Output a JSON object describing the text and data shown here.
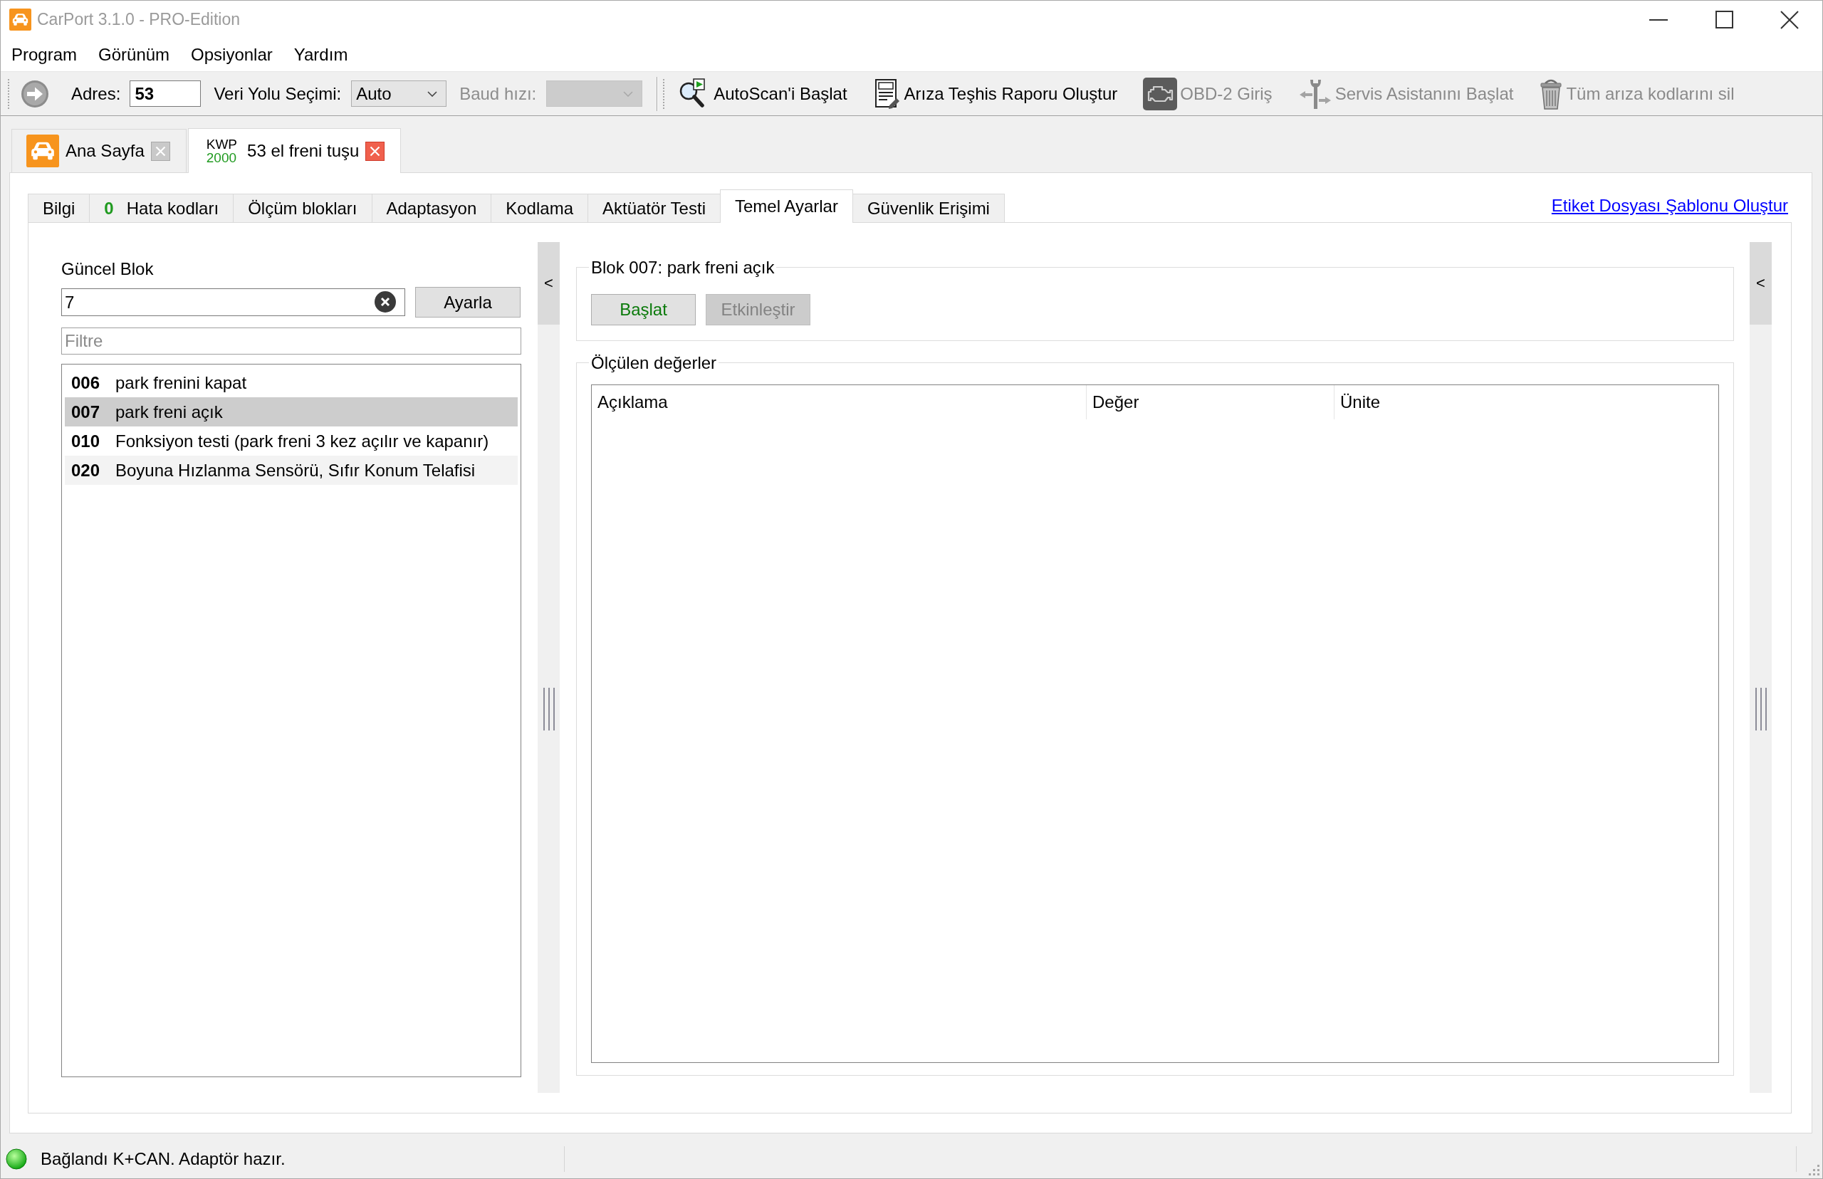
{
  "window": {
    "title": "CarPort 3.1.0 - PRO-Edition"
  },
  "menu": [
    "Program",
    "Görünüm",
    "Opsiyonlar",
    "Yardım"
  ],
  "toolbar": {
    "address": {
      "label": "Adres:",
      "value": "53"
    },
    "bus_select": {
      "label": "Veri Yolu Seçimi:",
      "value": "Auto"
    },
    "baud_select": {
      "label": "Baud hızı:",
      "disabled": true
    },
    "actions": [
      {
        "kind": "autoscan",
        "label": "AutoScan'i Başlat",
        "disabled": false
      },
      {
        "kind": "report",
        "label": "Arıza Teşhis Raporu Oluştur",
        "disabled": false
      },
      {
        "kind": "obd",
        "label": "OBD-2 Giriş",
        "disabled": true
      },
      {
        "kind": "service",
        "label": "Servis Asistanını Başlat",
        "disabled": true
      },
      {
        "kind": "clear_codes",
        "label": "Tüm arıza kodlarını sil",
        "disabled": true
      }
    ]
  },
  "document_tabs": [
    {
      "kind": "home",
      "label": "Ana Sayfa",
      "selected": false
    },
    {
      "kind": "module",
      "protocol": [
        "KWP",
        "2000"
      ],
      "label": "53 el freni tuşu",
      "selected": true
    }
  ],
  "module_tabs": [
    {
      "label": "Bilgi",
      "selected": false
    },
    {
      "count": "0",
      "label": "Hata kodları",
      "selected": false
    },
    {
      "label": "Ölçüm blokları",
      "selected": false
    },
    {
      "label": "Adaptasyon",
      "selected": false
    },
    {
      "label": "Kodlama",
      "selected": false
    },
    {
      "label": "Aktüatör Testi",
      "selected": false
    },
    {
      "label": "Temel Ayarlar",
      "selected": true
    },
    {
      "label": "Güvenlik Erişimi",
      "selected": false
    }
  ],
  "template_link": "Etiket Dosyası Şablonu Oluştur",
  "current_block": {
    "label": "Güncel Blok",
    "value": "7",
    "button": "Ayarla"
  },
  "filter": {
    "placeholder": "Filtre"
  },
  "blocks": [
    {
      "number": "006",
      "name": "park frenini kapat",
      "selected": false
    },
    {
      "number": "007",
      "name": "park freni açık",
      "selected": true
    },
    {
      "number": "010",
      "name": "Fonksiyon testi (park freni 3 kez açılır ve kapanır)",
      "selected": false
    },
    {
      "number": "020",
      "name": "Boyuna Hızlanma Sensörü, Sıfır Konum Telafisi",
      "selected": false
    }
  ],
  "splitters": [
    {
      "toggle": "<"
    },
    {
      "toggle": "<"
    }
  ],
  "block_group": {
    "title": "Blok 007: park freni açık",
    "buttons": [
      {
        "kind": "start",
        "label": "Başlat",
        "disabled": false
      },
      {
        "kind": "activate",
        "label": "Etkinleştir",
        "disabled": true
      }
    ]
  },
  "measured_values": {
    "title": "Ölçülen değerler",
    "columns": [
      "Açıklama",
      "Değer",
      "Ünite"
    ]
  },
  "status_bar": {
    "connected": true,
    "text": "Bağlandı K+CAN. Adaptör hazır."
  }
}
